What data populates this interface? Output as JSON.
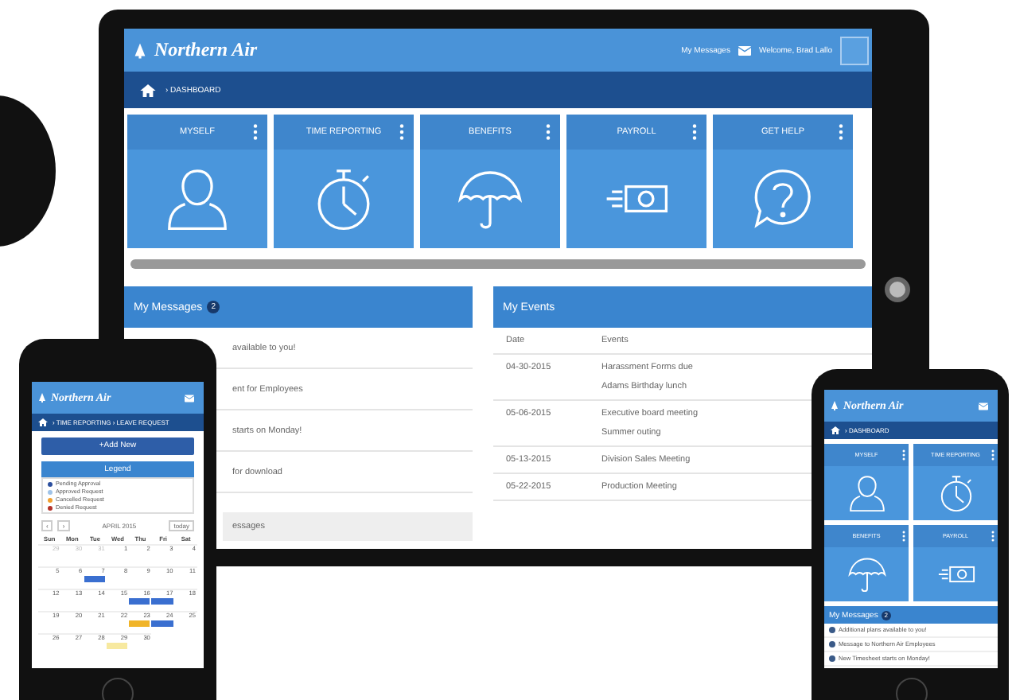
{
  "tablet": {
    "brand": "Northern Air",
    "messages_link": "My Messages",
    "user_menu": "Welcome, Brad Lallo",
    "breadcrumb": "› DASHBOARD",
    "tiles": [
      {
        "label": "MYSELF",
        "kind": "person"
      },
      {
        "label": "TIME REPORTING",
        "kind": "stopwatch"
      },
      {
        "label": "BENEFITS",
        "kind": "umbrella"
      },
      {
        "label": "PAYROLL",
        "kind": "money"
      },
      {
        "label": "GET HELP",
        "kind": "help"
      }
    ],
    "messages": {
      "title": "My Messages",
      "badge": "2",
      "items": [
        "available to you!",
        "ent for Employees",
        "starts on Monday!",
        "for download"
      ],
      "footer": "essages"
    },
    "events": {
      "title": "My Events",
      "columns": [
        "Date",
        "Events"
      ],
      "rows": [
        {
          "date": "04-30-2015",
          "events": [
            "Harassment Forms due",
            "Adams Birthday lunch"
          ]
        },
        {
          "date": "05-06-2015",
          "events": [
            "Executive board meeting",
            "Summer outing"
          ]
        },
        {
          "date": "05-13-2015",
          "events": [
            "Division Sales Meeting"
          ]
        },
        {
          "date": "05-22-2015",
          "events": [
            "Production Meeting"
          ]
        }
      ]
    }
  },
  "phone_left": {
    "brand": "Northern Air",
    "breadcrumb": "› TIME REPORTING › LEAVE REQUEST",
    "add_button": "+Add New",
    "legend": {
      "title": "Legend",
      "items": [
        {
          "label": "Pending Approval",
          "color": "#2b4f9e"
        },
        {
          "label": "Approved Request",
          "color": "#9fc3e8"
        },
        {
          "label": "Cancelled Request",
          "color": "#f0a030"
        },
        {
          "label": "Denied Request",
          "color": "#b5332a"
        }
      ]
    },
    "calendar": {
      "prev": "‹",
      "next": "›",
      "month": "APRIL 2015",
      "today": "today",
      "weekdays": [
        "Sun",
        "Mon",
        "Tue",
        "Wed",
        "Thu",
        "Fri",
        "Sat"
      ],
      "weeks": [
        [
          {
            "day": "29",
            "muted": true
          },
          {
            "day": "30",
            "muted": true
          },
          {
            "day": "31",
            "muted": true
          },
          {
            "day": "1",
            "muted": false
          },
          {
            "day": "2",
            "muted": false
          },
          {
            "day": "3",
            "muted": false
          },
          {
            "day": "4",
            "muted": false
          }
        ],
        [
          {
            "day": "5",
            "muted": false
          },
          {
            "day": "6",
            "muted": false
          },
          {
            "day": "7",
            "muted": false,
            "color": "#3a6fd0"
          },
          {
            "day": "8",
            "muted": false
          },
          {
            "day": "9",
            "muted": false
          },
          {
            "day": "10",
            "muted": false
          },
          {
            "day": "11",
            "muted": false
          }
        ],
        [
          {
            "day": "12",
            "muted": false
          },
          {
            "day": "13",
            "muted": false
          },
          {
            "day": "14",
            "muted": false
          },
          {
            "day": "15",
            "muted": false
          },
          {
            "day": "16",
            "muted": false,
            "color": "#3a6fd0"
          },
          {
            "day": "17",
            "muted": false,
            "color": "#3a6fd0"
          },
          {
            "day": "18",
            "muted": false
          }
        ],
        [
          {
            "day": "19",
            "muted": false
          },
          {
            "day": "20",
            "muted": false
          },
          {
            "day": "21",
            "muted": false
          },
          {
            "day": "22",
            "muted": false
          },
          {
            "day": "23",
            "muted": false,
            "color": "#f0b429"
          },
          {
            "day": "24",
            "muted": false,
            "color": "#3a6fd0"
          },
          {
            "day": "25",
            "muted": false
          }
        ],
        [
          {
            "day": "26",
            "muted": false
          },
          {
            "day": "27",
            "muted": false
          },
          {
            "day": "28",
            "muted": false
          },
          {
            "day": "29",
            "muted": false,
            "color": "#f7e9a0"
          },
          {
            "day": "30",
            "muted": false
          }
        ]
      ]
    }
  },
  "phone_right": {
    "brand": "Northern Air",
    "breadcrumb": "› DASHBOARD",
    "tiles": [
      {
        "label": "MYSELF",
        "kind": "person"
      },
      {
        "label": "TIME REPORTING",
        "kind": "stopwatch"
      },
      {
        "label": "BENEFITS",
        "kind": "umbrella"
      },
      {
        "label": "PAYROLL",
        "kind": "money"
      }
    ],
    "messages": {
      "title": "My Messages",
      "badge": "2",
      "items": [
        "Additional plans available to you!",
        "Message to Northern Air Employees",
        "New Timesheet starts on Monday!"
      ]
    }
  }
}
